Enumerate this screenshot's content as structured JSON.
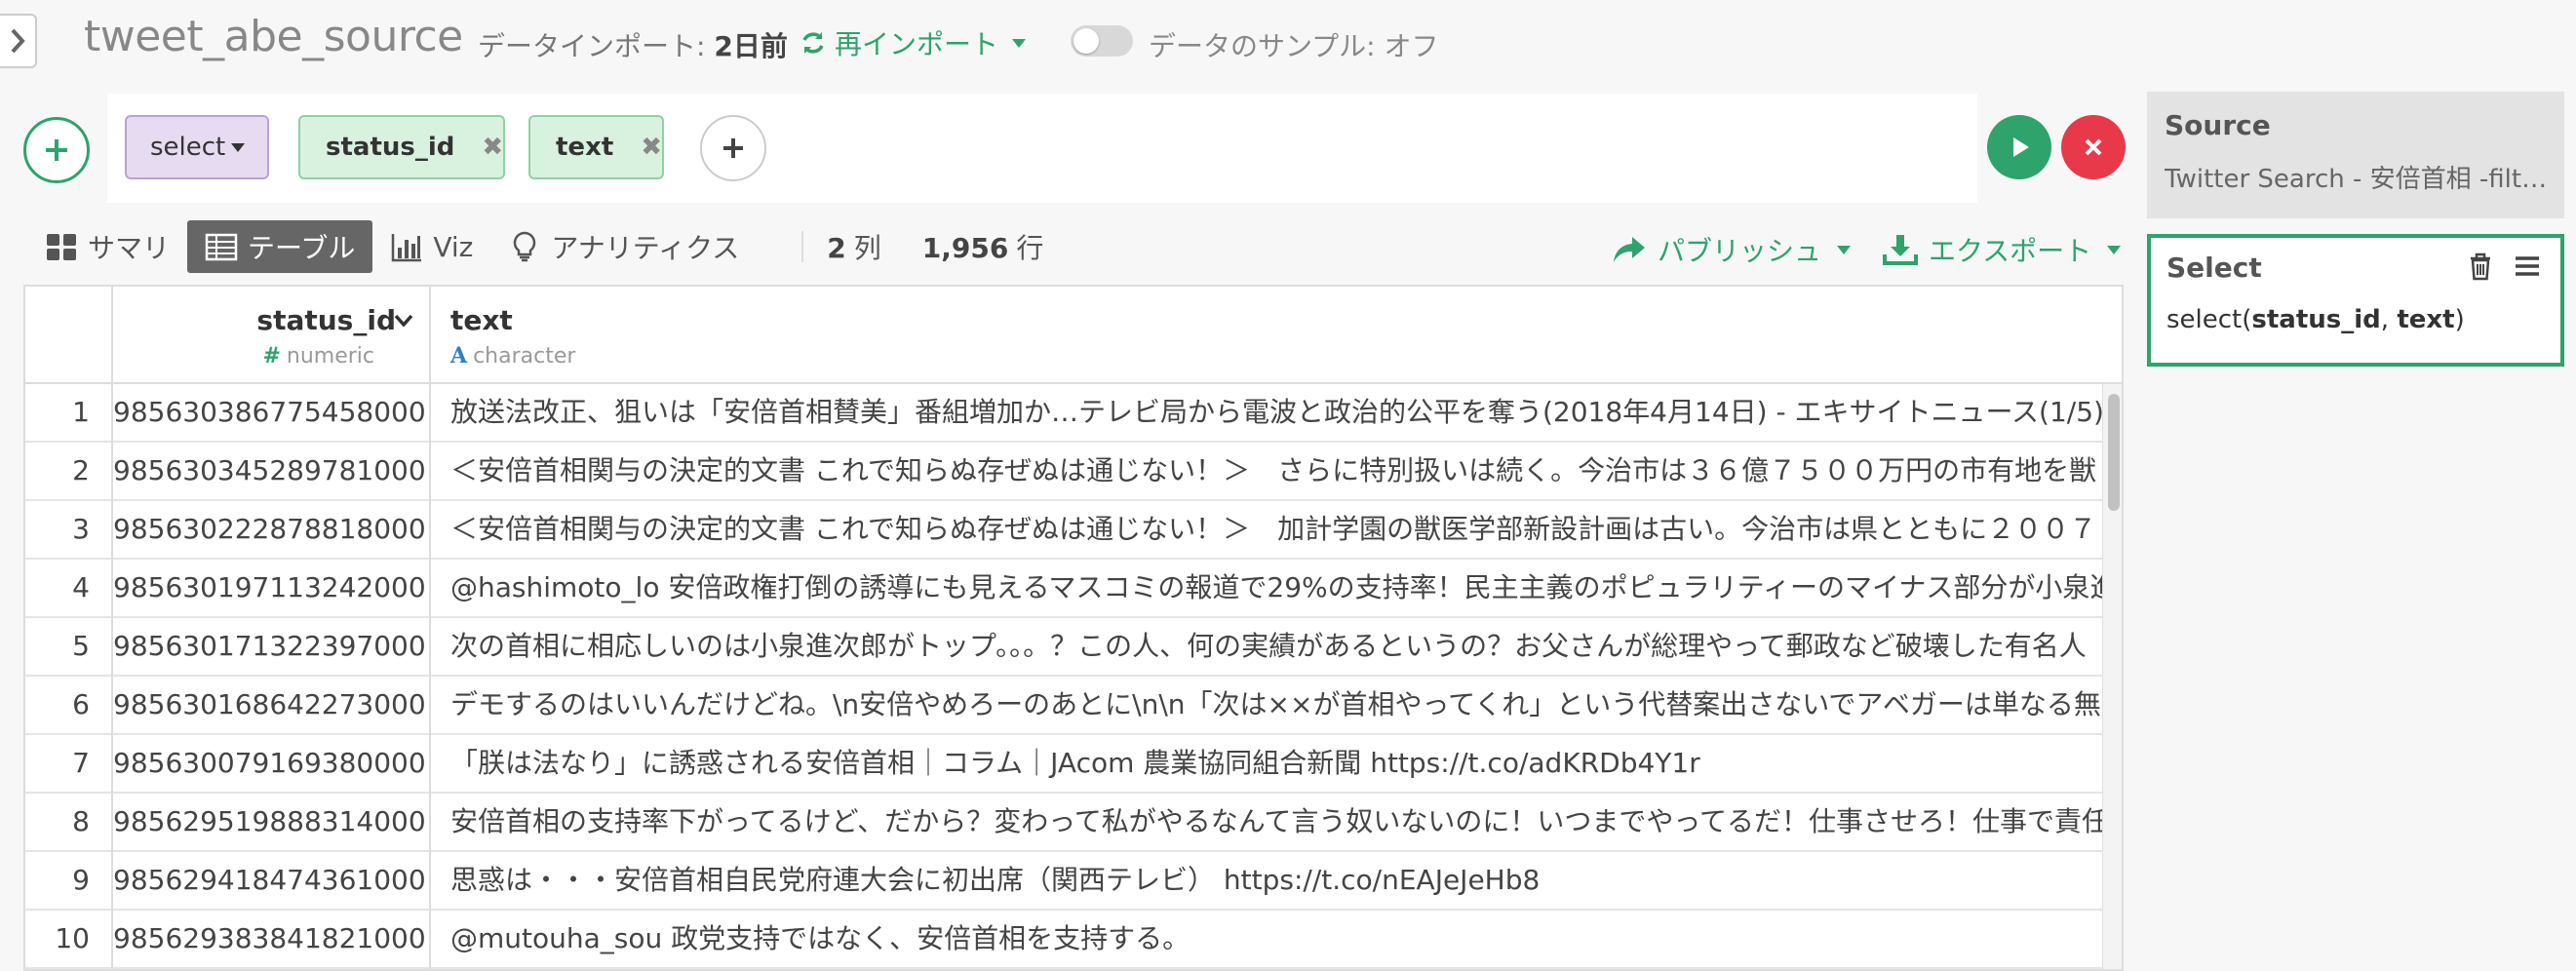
{
  "header": {
    "dataset_name": "tweet_abe_source",
    "import_label": "データインポート: ",
    "import_time": "2日前",
    "reimport_label": "再インポート",
    "sample_label": "データのサンプル: オフ"
  },
  "command": {
    "function": "select",
    "columns": [
      "status_id",
      "text"
    ]
  },
  "tabs": {
    "summary": "サマリ",
    "table": "テーブル",
    "viz": "Viz",
    "analytics": "アナリティクス",
    "col_count": "2",
    "col_unit": "列",
    "row_count": "1,956",
    "row_unit": "行",
    "publish": "パブリッシュ",
    "export": "エクスポート"
  },
  "table": {
    "columns": [
      {
        "name": "status_id",
        "type_icon": "#",
        "type": "numeric"
      },
      {
        "name": "text",
        "type_icon": "A",
        "type": "character"
      }
    ],
    "rows": [
      {
        "n": "1",
        "id": "985630386775458000",
        "text": "放送法改正、狙いは「安倍首相賛美」番組増加か…テレビ局から電波と政治的公平を奪う(2018年4月14日) - エキサイトニュース(1/5) ht"
      },
      {
        "n": "2",
        "id": "985630345289781000",
        "text": "＜安倍首相関与の決定的文書 これで知らぬ存ぜぬは通じない！＞　さらに特別扱いは続く。今治市は３６億７５００万円の市有地を獣"
      },
      {
        "n": "3",
        "id": "985630222878818000",
        "text": "＜安倍首相関与の決定的文書 これで知らぬ存ぜぬは通じない！＞　加計学園の獣医学部新設計画は古い。今治市は県とともに２００７"
      },
      {
        "n": "4",
        "id": "985630197113242000",
        "text": "@hashimoto_lo 安倍政権打倒の誘導にも見えるマスコミの報道で29%の支持率！民主主義のポピュラリティーのマイナス部分が小泉進"
      },
      {
        "n": "5",
        "id": "985630171322397000",
        "text": "次の首相に相応しいのは小泉進次郎がトップ。。。？この人、何の実績があるというの？お父さんが総理やって郵政など破壊した有名人"
      },
      {
        "n": "6",
        "id": "985630168642273000",
        "text": "デモするのはいいんだけどね。\\n安倍やめろーのあとに\\n\\n「次は××が首相やってくれ」という代替案出さないでアベガーは単なる無責"
      },
      {
        "n": "7",
        "id": "985630079169380000",
        "text": "「朕は法なり」に誘惑される安倍首相｜コラム｜JAcom 農業協同組合新聞 https://t.co/adKRDb4Y1r"
      },
      {
        "n": "8",
        "id": "985629519888314000",
        "text": "安倍首相の支持率下がってるけど、だから？変わって私がやるなんて言う奴いないのに！いつまでやってるだ！仕事させろ！仕事で責任"
      },
      {
        "n": "9",
        "id": "985629418474361000",
        "text": "思惑は・・・安倍首相自民党府連大会に初出席（関西テレビ） https://t.co/nEAJeJeHb8"
      },
      {
        "n": "10",
        "id": "985629383841821000",
        "text": "@mutouha_sou 政党支持ではなく、安倍首相を支持する。"
      }
    ]
  },
  "steps": {
    "source_title": "Source",
    "source_desc": "Twitter Search - 安倍首相 -filt…",
    "select_title": "Select",
    "select_fn": "select(",
    "select_col1": "status_id",
    "select_sep": ", ",
    "select_col2": "text",
    "select_close": ")"
  },
  "colors": {
    "accent": "#2ea36b",
    "danger": "#e8394a",
    "chip_select_bg": "#e7dbf2",
    "chip_col_bg": "#d9f2df"
  }
}
